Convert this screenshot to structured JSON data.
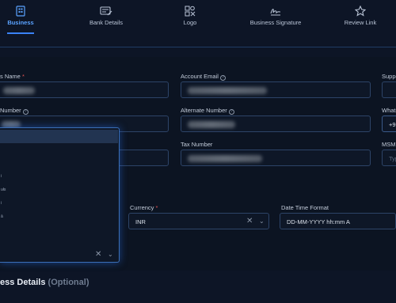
{
  "tabs": [
    {
      "label": "Business",
      "icon": "building-icon",
      "active": true
    },
    {
      "label": "Bank Details",
      "icon": "bank-card-icon",
      "active": false
    },
    {
      "label": "Logo",
      "icon": "logo-image-icon",
      "active": false
    },
    {
      "label": "Business Signature",
      "icon": "signature-icon",
      "active": false
    },
    {
      "label": "Review Link",
      "icon": "star-icon",
      "active": false
    }
  ],
  "form": {
    "business_name": {
      "label": "s Name",
      "required_mark": "*"
    },
    "account_email": {
      "label": "Account Email"
    },
    "support": {
      "label": "Suppo"
    },
    "phone_number": {
      "label": "Number"
    },
    "alternate_number": {
      "label": "Alternate Number"
    },
    "whatsapp": {
      "label": "Whats",
      "value": "+9"
    },
    "tax_number": {
      "label": "Tax Number"
    },
    "msme": {
      "label": "MSME",
      "placeholder": "Typ"
    },
    "currency": {
      "label": "Currency",
      "required_mark": "*",
      "value": "INR"
    },
    "date_time_format": {
      "label": "Date Time Format",
      "value": "DD-MM-YYYY hh:mm A"
    }
  },
  "dropdown": {
    "items": [
      "",
      "",
      "",
      "i",
      "ułs",
      "i",
      "ā",
      "",
      "",
      ""
    ]
  },
  "section": {
    "title": "ess Details",
    "optional": "(Optional)"
  },
  "colors": {
    "accent": "#3b82f6",
    "background": "#0d1526",
    "field_border": "#2d4468"
  }
}
